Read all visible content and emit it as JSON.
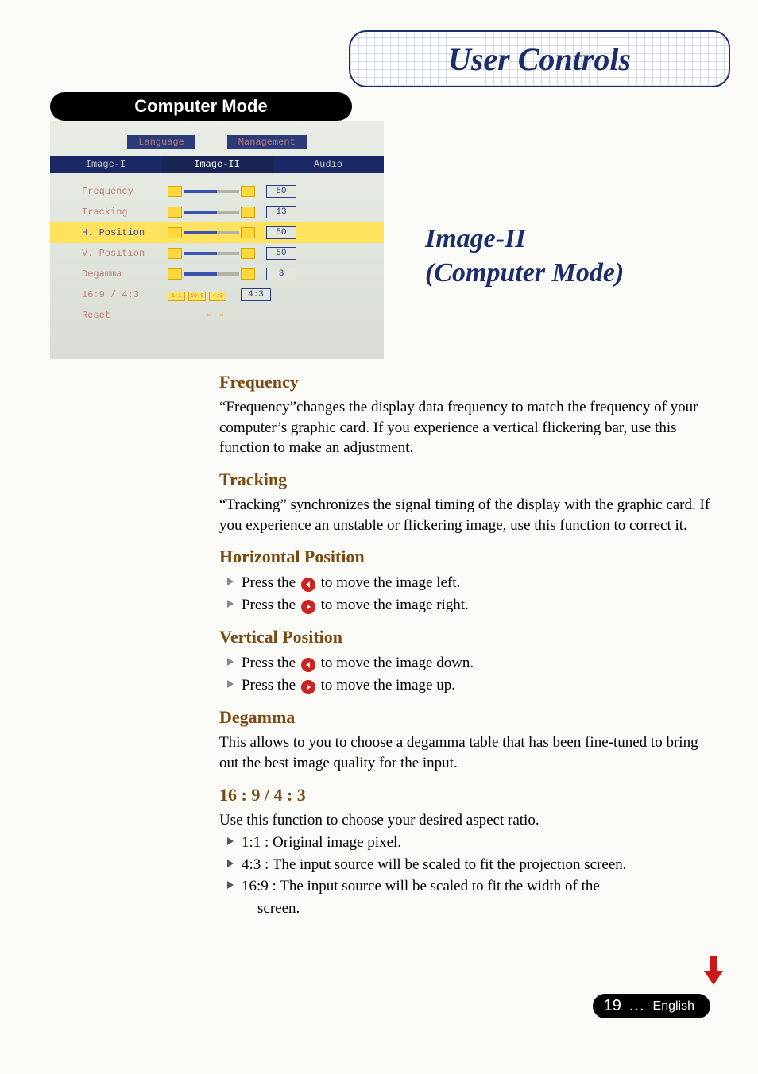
{
  "banner_title": "User Controls",
  "mode_pill": "Computer Mode",
  "osd": {
    "top_tabs": {
      "left": "Language",
      "right": "Management"
    },
    "mid_tabs": {
      "left": "Image-I",
      "center": "Image-II",
      "right": "Audio"
    },
    "rows": {
      "frequency": {
        "label": "Frequency",
        "value": "50"
      },
      "tracking": {
        "label": "Tracking",
        "value": "13"
      },
      "hpos": {
        "label": "H. Position",
        "value": "50"
      },
      "vpos": {
        "label": "V. Position",
        "value": "50"
      },
      "degamma": {
        "label": "Degamma",
        "value": "3"
      },
      "aspect": {
        "label": "16:9 / 4:3",
        "value": "4:3"
      },
      "reset": {
        "label": "Reset"
      }
    }
  },
  "section_title_l1": "Image-II",
  "section_title_l2": "(Computer Mode)",
  "body": {
    "frequency_h": "Frequency",
    "frequency_p": "“Frequency”changes the display data frequency to match the frequency of your computer’s graphic card. If you experience a vertical flickering bar, use this function to make an adjustment.",
    "tracking_h": "Tracking",
    "tracking_p": "“Tracking” synchronizes the signal timing of the display with the graphic card. If you experience an unstable or flickering image, use this function to correct it.",
    "hpos_h": "Horizontal Position",
    "hpos_l1a": "Press the ",
    "hpos_l1b": " to move the image left.",
    "hpos_l2a": "Press the ",
    "hpos_l2b": " to move the image right.",
    "vpos_h": "Vertical Position",
    "vpos_l1a": "Press the ",
    "vpos_l1b": " to move the image down.",
    "vpos_l2a": "Press the ",
    "vpos_l2b": " to move the image up.",
    "degamma_h": "Degamma",
    "degamma_p": "This allows to you to choose a degamma table that has been fine-tuned to bring out the best image quality for the input.",
    "aspect_h": "16 : 9 / 4 : 3",
    "aspect_p": "Use this function to choose your desired aspect ratio.",
    "aspect_l1": "1:1 : Original image pixel.",
    "aspect_l2": "4:3 : The input source will be scaled to fit the projection screen.",
    "aspect_l3a": "16:9 : The input source will be scaled to fit the width of the",
    "aspect_l3b": "screen."
  },
  "footer": {
    "page": "19",
    "dots": "...",
    "lang": "English"
  }
}
